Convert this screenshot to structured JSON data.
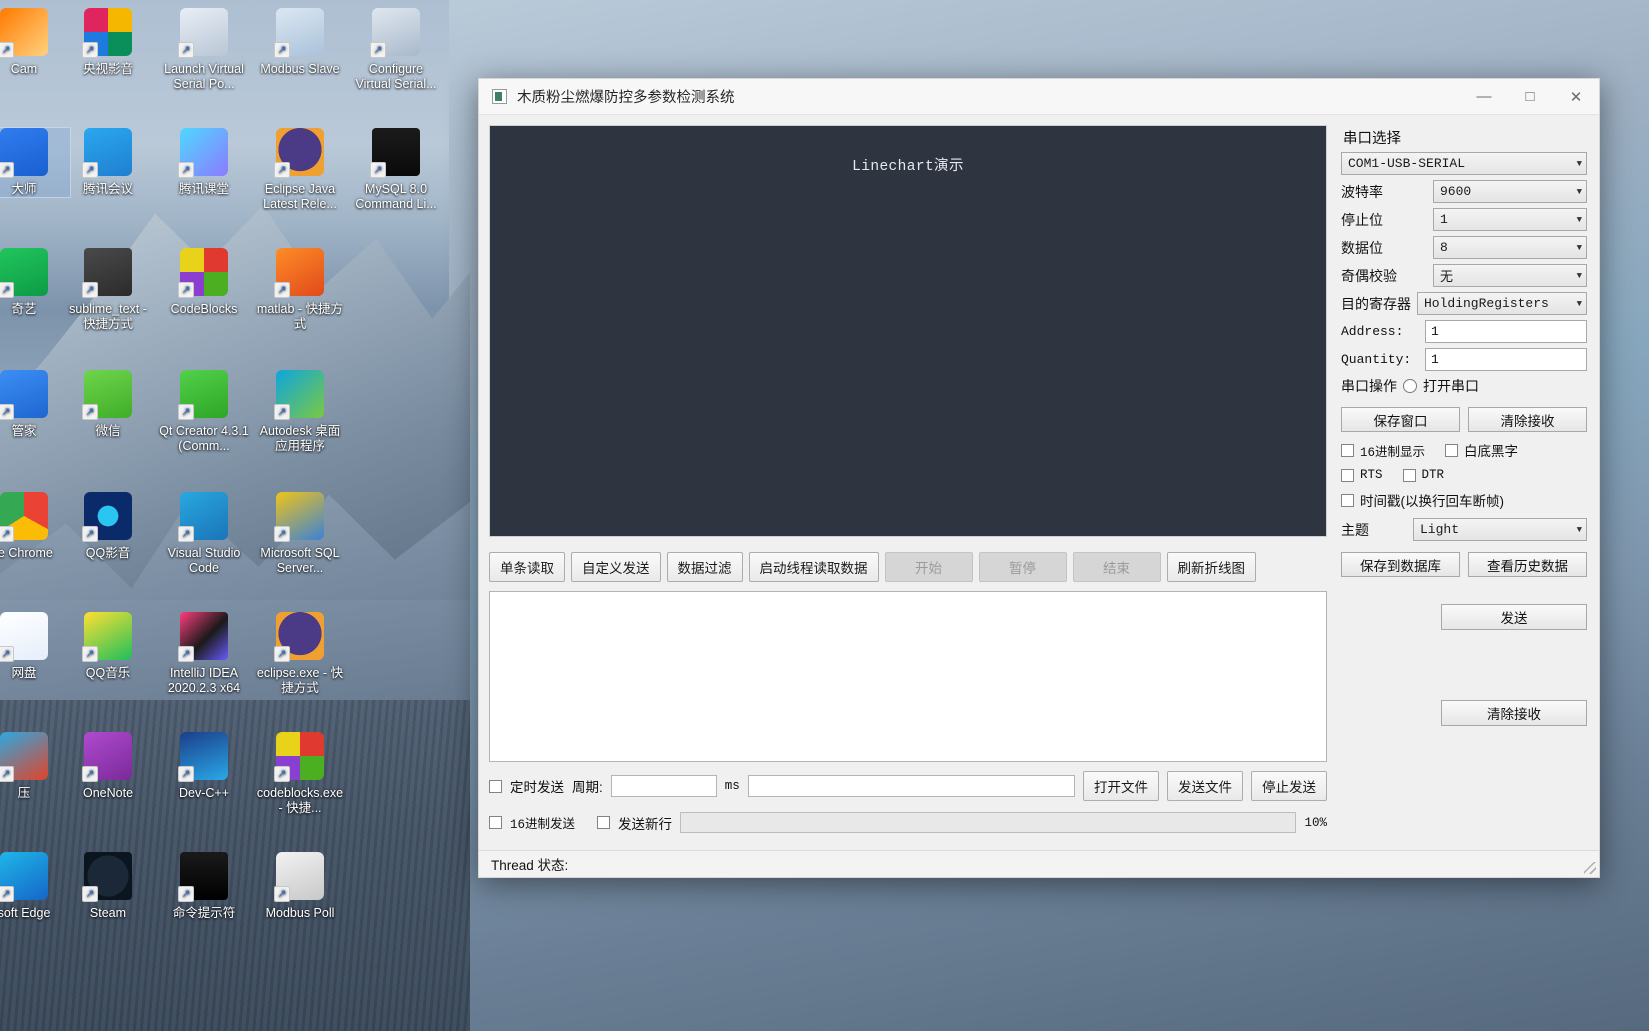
{
  "desktop": {
    "icons": [
      {
        "label": "Cam",
        "partial": true,
        "col": 0,
        "row": 0,
        "kind": "cam"
      },
      {
        "label": "央视影音",
        "col": 1,
        "row": 0,
        "kind": "cctv"
      },
      {
        "label": "Launch Virtual Serial Po...",
        "col": 2,
        "row": 0,
        "kind": "serial-pro"
      },
      {
        "label": "Modbus Slave",
        "col": 3,
        "row": 0,
        "kind": "modbus-slave"
      },
      {
        "label": "Configure Virtual Serial...",
        "col": 4,
        "row": 0,
        "kind": "serial-config"
      },
      {
        "label": "大师",
        "partial": true,
        "col": 0,
        "row": 1,
        "kind": "master",
        "selected": true
      },
      {
        "label": "腾讯会议",
        "col": 1,
        "row": 1,
        "kind": "tencent-meeting"
      },
      {
        "label": "腾讯课堂",
        "col": 2,
        "row": 1,
        "kind": "tencent-class"
      },
      {
        "label": "Eclipse Java Latest Rele...",
        "col": 3,
        "row": 1,
        "kind": "eclipse"
      },
      {
        "label": "MySQL 8.0 Command Li...",
        "col": 4,
        "row": 1,
        "kind": "mysql"
      },
      {
        "label": "奇艺",
        "partial": true,
        "col": 0,
        "row": 2,
        "kind": "iqiyi"
      },
      {
        "label": "sublime_text - 快捷方式",
        "col": 1,
        "row": 2,
        "kind": "sublime"
      },
      {
        "label": "CodeBlocks",
        "col": 2,
        "row": 2,
        "kind": "codeblocks"
      },
      {
        "label": "matlab - 快捷方式",
        "col": 3,
        "row": 2,
        "kind": "matlab"
      },
      {
        "label": "管家",
        "partial": true,
        "col": 0,
        "row": 3,
        "kind": "guanjia"
      },
      {
        "label": "微信",
        "col": 1,
        "row": 3,
        "kind": "wechat"
      },
      {
        "label": "Qt Creator 4.3.1 (Comm...",
        "col": 2,
        "row": 3,
        "kind": "qt"
      },
      {
        "label": "Autodesk 桌面应用程序",
        "col": 3,
        "row": 3,
        "kind": "autodesk"
      },
      {
        "label": "le Chrome",
        "partial": true,
        "col": 0,
        "row": 4,
        "kind": "chrome"
      },
      {
        "label": "QQ影音",
        "col": 1,
        "row": 4,
        "kind": "qqplayer"
      },
      {
        "label": "Visual Studio Code",
        "col": 2,
        "row": 4,
        "kind": "vscode"
      },
      {
        "label": "Microsoft SQL Server...",
        "col": 3,
        "row": 4,
        "kind": "mssql"
      },
      {
        "label": "网盘",
        "partial": true,
        "col": 0,
        "row": 5,
        "kind": "baidupan"
      },
      {
        "label": "QQ音乐",
        "col": 1,
        "row": 5,
        "kind": "qqmusic"
      },
      {
        "label": "IntelliJ IDEA 2020.2.3 x64",
        "col": 2,
        "row": 5,
        "kind": "idea"
      },
      {
        "label": "eclipse.exe - 快捷方式",
        "col": 3,
        "row": 5,
        "kind": "eclipse"
      },
      {
        "label": "压",
        "partial": true,
        "col": 0,
        "row": 6,
        "kind": "winrar"
      },
      {
        "label": "OneNote",
        "col": 1,
        "row": 6,
        "kind": "onenote"
      },
      {
        "label": "Dev-C++",
        "col": 2,
        "row": 6,
        "kind": "devcpp"
      },
      {
        "label": "codeblocks.exe - 快捷...",
        "col": 3,
        "row": 6,
        "kind": "codeblocks"
      },
      {
        "label": "soft Edge",
        "partial": true,
        "col": 0,
        "row": 7,
        "kind": "edge"
      },
      {
        "label": "Steam",
        "col": 1,
        "row": 7,
        "kind": "steam"
      },
      {
        "label": "命令提示符",
        "col": 2,
        "row": 7,
        "kind": "cmd"
      },
      {
        "label": "Modbus Poll",
        "col": 3,
        "row": 7,
        "kind": "modbus-poll"
      }
    ]
  },
  "window": {
    "title": "木质粉尘燃爆防控多参数检测系统",
    "controls": {
      "minimize": "—",
      "maximize": "□",
      "close": "✕"
    }
  },
  "chart": {
    "title": "Linechart演示",
    "background": "#2e3440",
    "title_color": "#e7e9ee"
  },
  "chart_data": {
    "type": "line",
    "title": "Linechart演示",
    "series": [],
    "x": [],
    "xlabel": "",
    "ylabel": "",
    "grid": false,
    "legend": "none",
    "note": "Empty plot area — no data series rendered"
  },
  "toolbar": {
    "buttons": [
      {
        "label": "单条读取",
        "enabled": true
      },
      {
        "label": "自定义发送",
        "enabled": true
      },
      {
        "label": "数据过滤",
        "enabled": true
      },
      {
        "label": "启动线程读取数据",
        "enabled": true
      },
      {
        "label": "开始",
        "enabled": false
      },
      {
        "label": "暂停",
        "enabled": false
      },
      {
        "label": "结束",
        "enabled": false
      },
      {
        "label": "刷新折线图",
        "enabled": true
      }
    ]
  },
  "receive_area": {
    "value": ""
  },
  "bottom": {
    "timed_send_label": "定时发送",
    "timed_send_checked": false,
    "period_label": "周期:",
    "period_value": "",
    "ms_unit": "ms",
    "send_text_value": "",
    "hex_send_label": "16进制发送",
    "hex_send_checked": false,
    "newline_label": "发送新行",
    "newline_checked": false,
    "progress_percent": "10%",
    "progress_value": 10,
    "progress_color": "#06a81e",
    "open_file_label": "打开文件",
    "send_file_label": "发送文件",
    "stop_send_label": "停止发送"
  },
  "side_buttons": {
    "send_label": "发送",
    "clear_receive_label": "清除接收"
  },
  "serial_panel": {
    "heading": "串口选择",
    "port_value": "COM1-USB-SERIAL",
    "baud_label": "波特率",
    "baud_value": "9600",
    "stopbits_label": "停止位",
    "stopbits_value": "1",
    "databits_label": "数据位",
    "databits_value": "8",
    "parity_label": "奇偶校验",
    "parity_value": "无",
    "register_label": "目的寄存器",
    "register_value": "HoldingRegisters",
    "address_label": "Address:",
    "address_value": "1",
    "quantity_label": "Quantity:",
    "quantity_value": "1",
    "operation_label": "串口操作",
    "open_port_label": "打开串口",
    "open_port_checked": false,
    "save_window_label": "保存窗口",
    "clear_receive_label": "清除接收",
    "hex_display_label": "16进制显示",
    "hex_display_checked": false,
    "white_bg_label": "白底黑字",
    "white_bg_checked": false,
    "rts_label": "RTS",
    "rts_checked": false,
    "dtr_label": "DTR",
    "dtr_checked": false,
    "timestamp_label": "时间戳(以换行回车断帧)",
    "timestamp_checked": false,
    "theme_label": "主题",
    "theme_value": "Light",
    "save_db_label": "保存到数据库",
    "view_history_label": "查看历史数据"
  },
  "statusbar": {
    "text": "Thread 状态:"
  }
}
